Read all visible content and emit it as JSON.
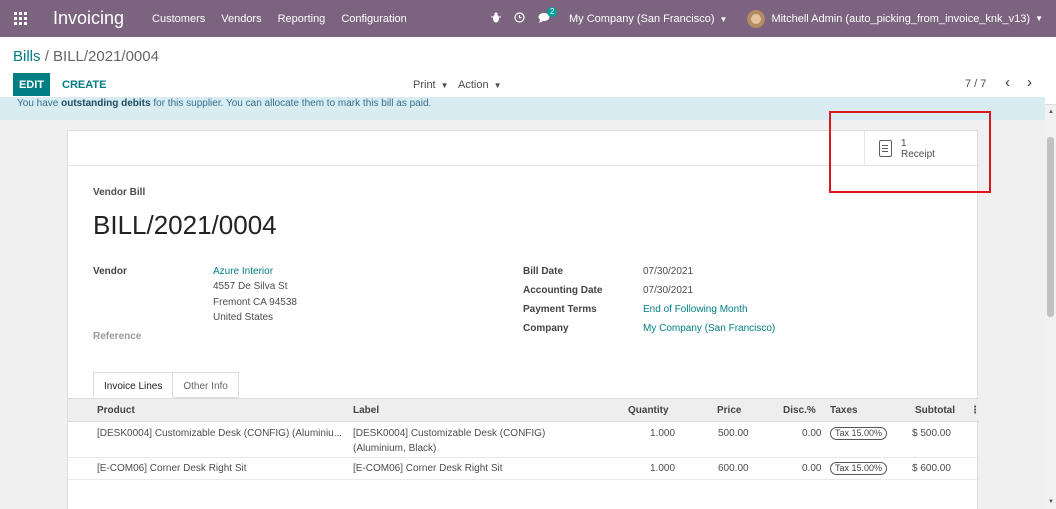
{
  "navbar": {
    "app_name": "Invoicing",
    "menu": [
      "Customers",
      "Vendors",
      "Reporting",
      "Configuration"
    ],
    "chat_badge": "2",
    "company": "My Company (San Francisco)",
    "user": "Mitchell Admin (auto_picking_from_invoice_knk_v13)",
    "bg_color": "#7c6380"
  },
  "control_panel": {
    "breadcrumb_parent": "Bills",
    "breadcrumb_sep": "/",
    "breadcrumb_current": "BILL/2021/0004",
    "edit_label": "EDIT",
    "create_label": "CREATE",
    "print_label": "Print",
    "action_label": "Action",
    "pager": "7 / 7"
  },
  "alert": {
    "prefix": "You have",
    "bold": "outstanding debits",
    "suffix": "for this supplier. You can allocate them to mark this bill as paid."
  },
  "smart_button": {
    "count": "1",
    "label": "Receipt",
    "icon": "receipt-icon"
  },
  "form": {
    "doc_type": "Vendor Bill",
    "name": "BILL/2021/0004",
    "vendor_label": "Vendor",
    "vendor_name": "Azure Interior",
    "vendor_address": [
      "4557 De Silva St",
      "Fremont CA 94538",
      "United States"
    ],
    "reference_label": "Reference",
    "bill_date_label": "Bill Date",
    "bill_date": "07/30/2021",
    "accounting_date_label": "Accounting Date",
    "accounting_date": "07/30/2021",
    "payment_terms_label": "Payment Terms",
    "payment_terms": "End of Following Month",
    "company_label": "Company",
    "company": "My Company (San Francisco)"
  },
  "tabs": [
    "Invoice Lines",
    "Other Info"
  ],
  "lines": {
    "headers": {
      "product": "Product",
      "label": "Label",
      "quantity": "Quantity",
      "price": "Price",
      "discount": "Disc.%",
      "taxes": "Taxes",
      "subtotal": "Subtotal"
    },
    "rows": [
      {
        "product": "[DESK0004] Customizable Desk (CONFIG) (Aluminiu...",
        "label_line1": "[DESK0004] Customizable Desk (CONFIG)",
        "label_line2": "(Aluminium, Black)",
        "quantity": "1.000",
        "price": "500.00",
        "discount": "0.00",
        "tax": "Tax 15.00%",
        "subtotal": "$ 500.00"
      },
      {
        "product": "[E-COM06] Corner Desk Right Sit",
        "label_line1": "[E-COM06] Corner Desk Right Sit",
        "label_line2": "",
        "quantity": "1.000",
        "price": "600.00",
        "discount": "0.00",
        "tax": "Tax 15.00%",
        "subtotal": "$ 600.00"
      }
    ]
  },
  "colors": {
    "accent": "#017e84",
    "highlight_box": "#e0151b"
  }
}
